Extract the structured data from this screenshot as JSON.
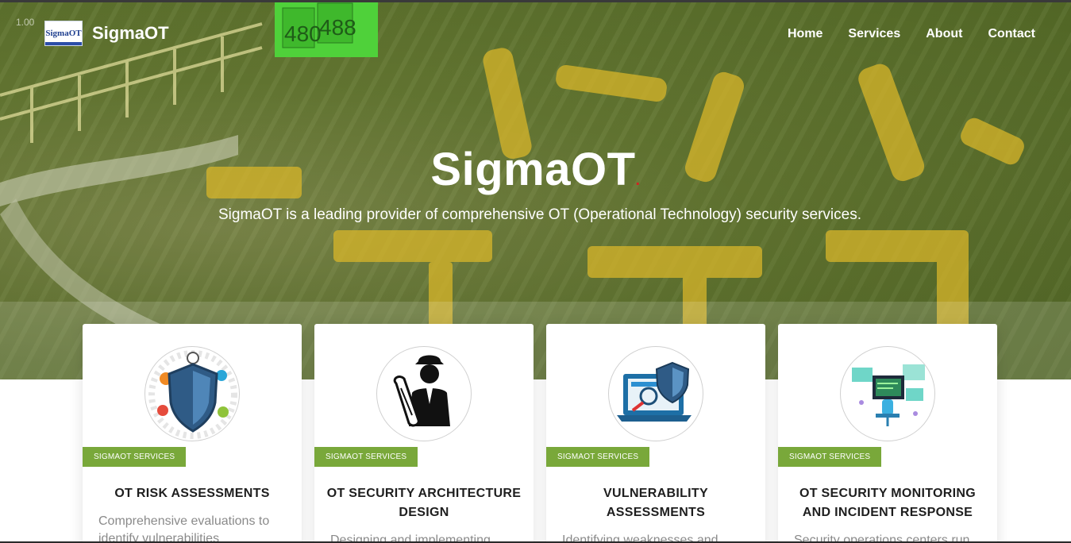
{
  "nav": {
    "brand_logo_text": "SigmaOT",
    "brand_name": "SigmaOT",
    "links": [
      "Home",
      "Services",
      "About",
      "Contact"
    ]
  },
  "hero": {
    "title": "SigmaOT",
    "title_dot": ".",
    "subtitle": "SigmaOT is a leading provider of comprehensive OT (Operational Technology) security services.",
    "sign_numbers": [
      "480",
      "488"
    ],
    "corner_readout": "1.00"
  },
  "cards": [
    {
      "icon": "shield-icon",
      "badge": "SIGMAOT SERVICES",
      "title": "OT RISK ASSESSMENTS",
      "desc": "Comprehensive evaluations to identify vulnerabilities"
    },
    {
      "icon": "engineer-blueprint-icon",
      "badge": "SIGMAOT SERVICES",
      "title": "OT SECURITY ARCHITECTURE DESIGN",
      "desc": "Designing and implementing"
    },
    {
      "icon": "laptop-shield-icon",
      "badge": "SIGMAOT SERVICES",
      "title": "VULNERABILITY ASSESSMENTS",
      "desc": "Identifying weaknesses and"
    },
    {
      "icon": "monitoring-desk-icon",
      "badge": "SIGMAOT SERVICES",
      "title": "OT SECURITY MONITORING AND INCIDENT RESPONSE",
      "desc": "Security operations centers run"
    }
  ],
  "colors": {
    "badge_green": "#79a83a",
    "hero_overlay": "#5c7828",
    "title_dot_red": "#d32222"
  }
}
